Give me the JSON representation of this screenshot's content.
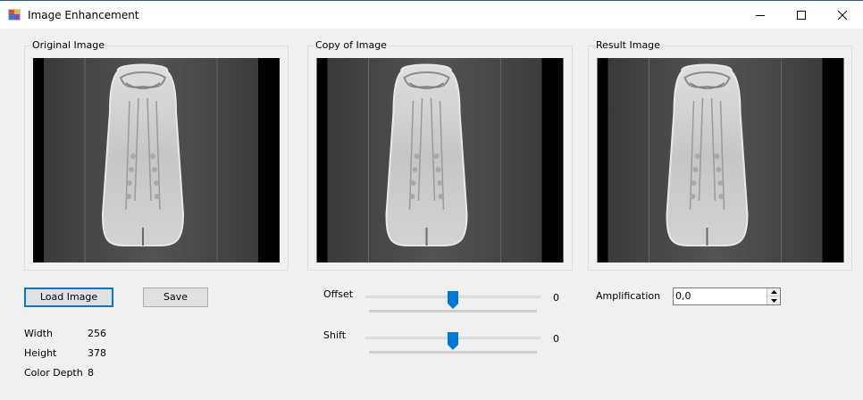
{
  "window": {
    "title": "Image Enhancement",
    "icon": "app-window-icon",
    "controls": [
      "minimize-icon",
      "maximize-icon",
      "close-icon"
    ]
  },
  "groups": {
    "original": {
      "label": "Original Image"
    },
    "copy": {
      "label": "Copy of Image"
    },
    "result": {
      "label": "Result Image"
    }
  },
  "buttons": {
    "load": "Load Image",
    "save": "Save"
  },
  "info": {
    "width_label": "Width",
    "width_value": "256",
    "height_label": "Height",
    "height_value": "378",
    "depth_label": "Color Depth",
    "depth_value": "8"
  },
  "offset": {
    "label": "Offset",
    "value": "0",
    "position": 0.5
  },
  "shift": {
    "label": "Shift",
    "value": "0",
    "position": 0.5
  },
  "amplification": {
    "label": "Amplification",
    "value": "0,0"
  },
  "colors": {
    "accent": "#0078d7",
    "titlebar_border": "#1f5fa6"
  }
}
